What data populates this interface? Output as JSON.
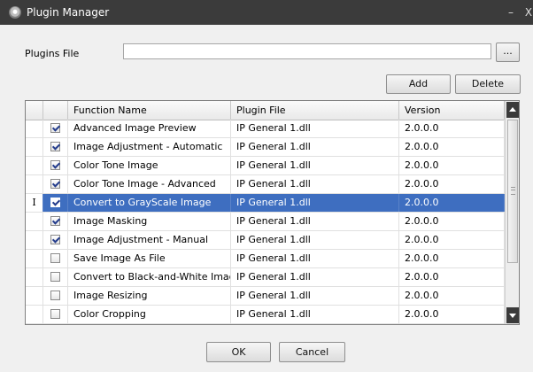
{
  "window": {
    "title": "Plugin Manager",
    "minimize": "–",
    "close": "X"
  },
  "plugins_file": {
    "label": "Plugins File",
    "value": "",
    "placeholder": "",
    "browse_label": "..."
  },
  "actions": {
    "add_label": "Add",
    "delete_label": "Delete"
  },
  "grid": {
    "columns": [
      "Function Name",
      "Plugin File",
      "Version"
    ],
    "rows": [
      {
        "checked": true,
        "selected": false,
        "name": "Advanced Image Preview",
        "file": "IP General 1.dll",
        "version": "2.0.0.0"
      },
      {
        "checked": true,
        "selected": false,
        "name": "Image Adjustment - Automatic",
        "file": "IP General 1.dll",
        "version": "2.0.0.0"
      },
      {
        "checked": true,
        "selected": false,
        "name": "Color Tone Image",
        "file": "IP General 1.dll",
        "version": "2.0.0.0"
      },
      {
        "checked": true,
        "selected": false,
        "name": "Color Tone Image - Advanced",
        "file": "IP General 1.dll",
        "version": "2.0.0.0"
      },
      {
        "checked": true,
        "selected": true,
        "name": "Convert to GrayScale Image",
        "file": "IP General 1.dll",
        "version": "2.0.0.0",
        "indicator": "I"
      },
      {
        "checked": true,
        "selected": false,
        "name": "Image Masking",
        "file": "IP General 1.dll",
        "version": "2.0.0.0"
      },
      {
        "checked": true,
        "selected": false,
        "name": "Image Adjustment - Manual",
        "file": "IP General 1.dll",
        "version": "2.0.0.0"
      },
      {
        "checked": false,
        "selected": false,
        "name": "Save Image As File",
        "file": "IP General 1.dll",
        "version": "2.0.0.0"
      },
      {
        "checked": false,
        "selected": false,
        "name": "Convert to Black-and-White Image",
        "file": "IP General 1.dll",
        "version": "2.0.0.0"
      },
      {
        "checked": false,
        "selected": false,
        "name": "Image Resizing",
        "file": "IP General 1.dll",
        "version": "2.0.0.0"
      },
      {
        "checked": false,
        "selected": false,
        "name": "Color Cropping",
        "file": "IP General 1.dll",
        "version": "2.0.0.0"
      }
    ]
  },
  "footer": {
    "ok_label": "OK",
    "cancel_label": "Cancel"
  },
  "colors": {
    "titlebar": "#3b3b3b",
    "selection": "#3e6ec0",
    "window_bg": "#f0f0f0"
  }
}
